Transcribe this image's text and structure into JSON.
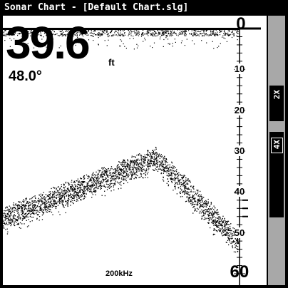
{
  "window": {
    "title": "Sonar Chart - [Default Chart.slg]"
  },
  "readout": {
    "depth_value": "39.6",
    "depth_unit": "ft",
    "temperature": "48.0°",
    "frequency": "200kHz"
  },
  "depth_scale": {
    "ticks": [
      {
        "label": "0",
        "value": 0
      },
      {
        "label": "10",
        "value": 10
      },
      {
        "label": "20",
        "value": 20
      },
      {
        "label": "30",
        "value": 30
      },
      {
        "label": "40",
        "value": 40
      },
      {
        "label": "50",
        "value": 50
      },
      {
        "label": "60",
        "value": 60
      }
    ],
    "max": 60
  },
  "zoom_bar": {
    "top_label": "2X",
    "bottom_label": "4X"
  },
  "colors": {
    "background": "#000000",
    "chart": "#ffffff",
    "sidebar": "#a8a8a8"
  }
}
